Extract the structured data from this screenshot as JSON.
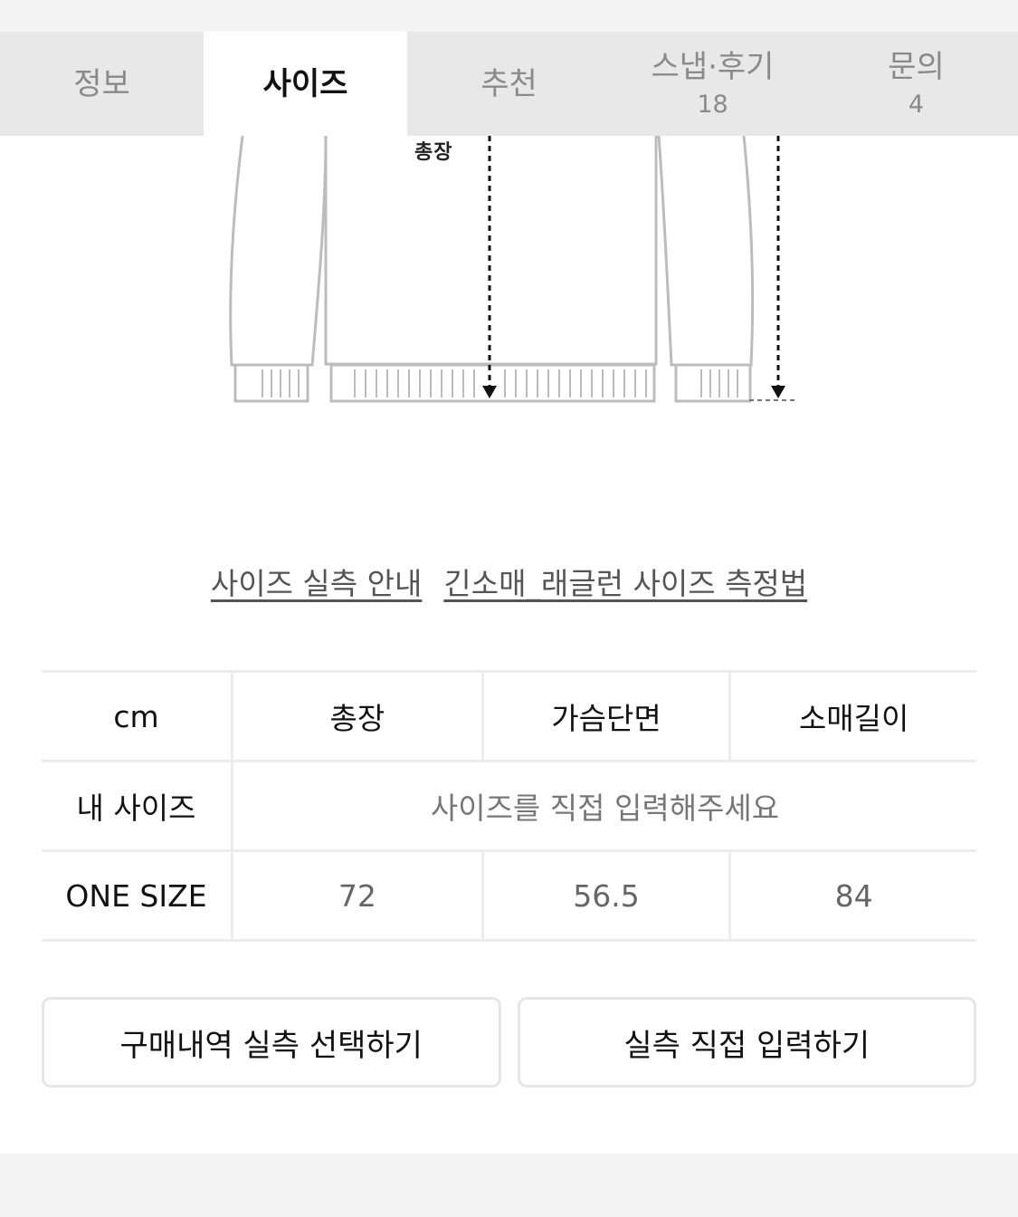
{
  "tabs": [
    {
      "label": "정보",
      "count": ""
    },
    {
      "label": "사이즈",
      "count": ""
    },
    {
      "label": "추천",
      "count": ""
    },
    {
      "label": "스냅·후기",
      "count": "18"
    },
    {
      "label": "문의",
      "count": "4"
    }
  ],
  "active_tab": "사이즈",
  "illustration": {
    "measure_label": "총장"
  },
  "links": [
    "사이즈 실측 안내",
    "긴소매_래글런 사이즈 측정법"
  ],
  "table": {
    "headers": [
      "cm",
      "총장",
      "가슴단면",
      "소매길이"
    ],
    "my_size": {
      "label": "내 사이즈",
      "placeholder": "사이즈를 직접 입력해주세요"
    },
    "rows": [
      {
        "label": "ONE SIZE",
        "values": [
          "72",
          "56.5",
          "84"
        ]
      }
    ]
  },
  "buttons": [
    "구매내역 실측 선택하기",
    "실측 직접 입력하기"
  ]
}
